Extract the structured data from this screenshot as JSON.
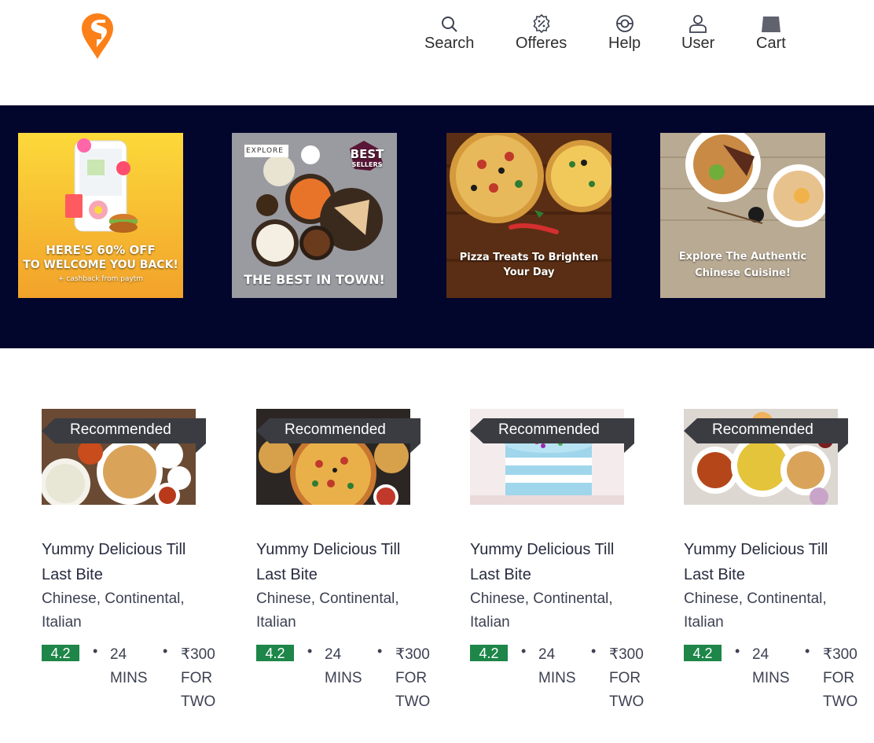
{
  "nav": {
    "search": "Search",
    "offers": "Offeres",
    "help": "Help",
    "user": "User",
    "cart": "Cart"
  },
  "offers": [
    {
      "line1": "HERE'S 60% OFF",
      "line2": "TO WELCOME YOU BACK!",
      "line3": "+ cashback from paytm"
    },
    {
      "tag": "EXPLORE",
      "badge1": "BEST",
      "badge2": "SELLERS",
      "caption": "THE BEST IN TOWN!"
    },
    {
      "caption1": "Pizza Treats To Brighten",
      "caption2": "Your Day"
    },
    {
      "caption1": "Explore The Authentic",
      "caption2": "Chinese Cuisine!"
    }
  ],
  "restaurants": [
    {
      "tag": "Recommended",
      "name": "Yummy Delicious Till Last Bite",
      "cuisine": "Chinese, Continental, Italian",
      "rating": "4.2",
      "time": "24 MINS",
      "price": "₹300 FOR TWO"
    },
    {
      "tag": "Recommended",
      "name": "Yummy Delicious Till Last Bite",
      "cuisine": "Chinese, Continental, Italian",
      "rating": "4.2",
      "time": "24 MINS",
      "price": "₹300 FOR TWO"
    },
    {
      "tag": "Recommended",
      "name": "Yummy Delicious Till Last Bite",
      "cuisine": "Chinese, Continental, Italian",
      "rating": "4.2",
      "time": "24 MINS",
      "price": "₹300 FOR TWO"
    },
    {
      "tag": "Recommended",
      "name": "Yummy Delicious Till Last Bite",
      "cuisine": "Chinese, Continental, Italian",
      "rating": "4.2",
      "time": "24 MINS",
      "price": "₹300 FOR TWO"
    }
  ],
  "colors": {
    "brand": "#fc8019",
    "banner_bg": "#02052c",
    "rating_bg": "#1d8648",
    "tag_bg": "#3a3c42"
  }
}
